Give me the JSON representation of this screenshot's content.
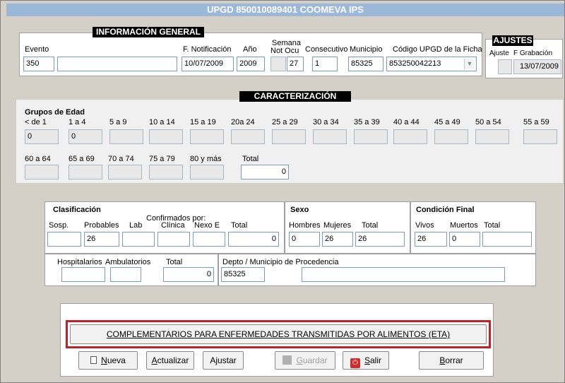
{
  "window": {
    "title": "UPGD 850010089401 COOMEVA IPS"
  },
  "general": {
    "header": "INFORMACIÓN GENERAL",
    "evento_label": "Evento",
    "evento_code": "350",
    "evento_desc": "",
    "fnotif_label": "F. Notificación",
    "fnotif": "10/07/2009",
    "anio_label": "Año",
    "anio": "2009",
    "semana_label_1": "Semana",
    "semana_label_2": "Not Ocu",
    "semana_not": "",
    "semana_ocu": "27",
    "consec_label": "Consecutivo",
    "consec": "1",
    "mun_label": "Municipio",
    "mun": "85325",
    "upgd_label": "Código UPGD de la Ficha",
    "upgd": "853250042213",
    "dropdown_icon": "chevron-down-icon"
  },
  "ajustes": {
    "header": "AJUSTES",
    "ajuste_label": "Ajuste",
    "fgrab_label": "F Grabación",
    "ajuste": "",
    "fgrab": "13/07/2009"
  },
  "caract": {
    "header": "CARACTERIZACIÓN",
    "title": "Grupos de Edad",
    "row1_labels": [
      "< de 1",
      "1 a 4",
      "5 a 9",
      "10 a 14",
      "15 a 19",
      "20a 24",
      "25 a 29",
      "30 a 34",
      "35 a 39",
      "40 a 44",
      "45 a 49",
      "50 a 54",
      "55 a 59"
    ],
    "row1_values": [
      "0",
      "0",
      "",
      "",
      "",
      "",
      "",
      "",
      "",
      "",
      "",
      "",
      ""
    ],
    "row2_labels": [
      "60 a 64",
      "65 a 69",
      "70 a 74",
      "75 a 79",
      "80 y más"
    ],
    "row2_values": [
      "",
      "",
      "",
      "",
      ""
    ],
    "total_label": "Total",
    "total": "0"
  },
  "clasif": {
    "title": "Clasificación",
    "confirmados": "Confirmados por:",
    "sosp_label": "Sosp.",
    "prob_label": "Probables",
    "lab_label": "Lab",
    "clin_label": "Clínica",
    "nexo_label": "Nexo E",
    "total_label": "Total",
    "sosp": "",
    "prob": "26",
    "lab": "",
    "clin": "",
    "nexo": "",
    "total": "0"
  },
  "sexo": {
    "title": "Sexo",
    "hom_label": "Hombres",
    "muj_label": "Mujeres",
    "total_label": "Total",
    "hom": "0",
    "muj": "26",
    "total": "26"
  },
  "cond": {
    "title": "Condición Final",
    "vivos_label": "Vivos",
    "muertos_label": "Muertos",
    "total_label": "Total",
    "vivos": "26",
    "muertos": "0",
    "total": ""
  },
  "hosp": {
    "hosp_label": "Hospitalarios",
    "amb_label": "Ambulatorios",
    "total_label": "Total",
    "hosp": "",
    "amb": "",
    "total": "0"
  },
  "proc": {
    "label": "Depto / Municipio de Procedencia",
    "code": "85325",
    "desc": ""
  },
  "buttons": {
    "complementarios": "COMPLEMENTARIOS PARA ENFERMEDADES TRANSMITIDAS POR ALIMENTOS (ETA)",
    "nueva_u": "N",
    "nueva_rest": "ueva",
    "actualizar_u": "A",
    "actualizar_rest": "ctualizar",
    "ajustar": "Ajustar",
    "guardar_u": "G",
    "guardar_rest": "uardar",
    "salir_u": "S",
    "salir_rest": "alir",
    "borrar_u": "B",
    "borrar_rest": "orrar"
  },
  "colors": {
    "highlight": "#c0202a",
    "title_bar": "#9bb8d8"
  }
}
